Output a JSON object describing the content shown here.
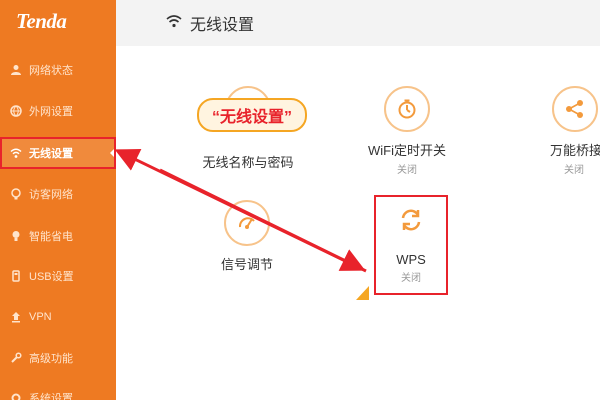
{
  "brand": {
    "logo_text": "Tenda"
  },
  "sidebar": {
    "items": [
      {
        "label": "网络状态",
        "icon": "person-icon",
        "active": false
      },
      {
        "label": "外网设置",
        "icon": "globe-icon",
        "active": false
      },
      {
        "label": "无线设置",
        "icon": "wifi-icon",
        "active": true
      },
      {
        "label": "访客网络",
        "icon": "guest-icon",
        "active": false
      },
      {
        "label": "智能省电",
        "icon": "bulb-icon",
        "active": false
      },
      {
        "label": "USB设置",
        "icon": "usb-icon",
        "active": false
      },
      {
        "label": "VPN",
        "icon": "vpn-icon",
        "active": false
      },
      {
        "label": "高级功能",
        "icon": "wrench-icon",
        "active": false
      },
      {
        "label": "系统设置",
        "icon": "gear-icon",
        "active": false
      }
    ]
  },
  "header": {
    "title": "无线设置",
    "icon": "wifi-icon"
  },
  "main": {
    "callout": "“无线设置”",
    "tiles": [
      {
        "label": "无线名称与密码",
        "status": "",
        "icon": "lock-icon"
      },
      {
        "label": "WiFi定时开关",
        "status": "关闭",
        "icon": "timer-icon"
      },
      {
        "label": "万能桥接",
        "status": "关闭",
        "icon": "share-icon"
      },
      {
        "label": "信号调节",
        "status": "",
        "icon": "signal-icon"
      },
      {
        "label": "WPS",
        "status": "关闭",
        "icon": "refresh-icon"
      }
    ]
  },
  "colors": {
    "sidebar_bg": "#ee7a22",
    "accent_red": "#e8232b",
    "icon_orange": "#f39a3c",
    "header_bg": "#f3f3f3"
  }
}
